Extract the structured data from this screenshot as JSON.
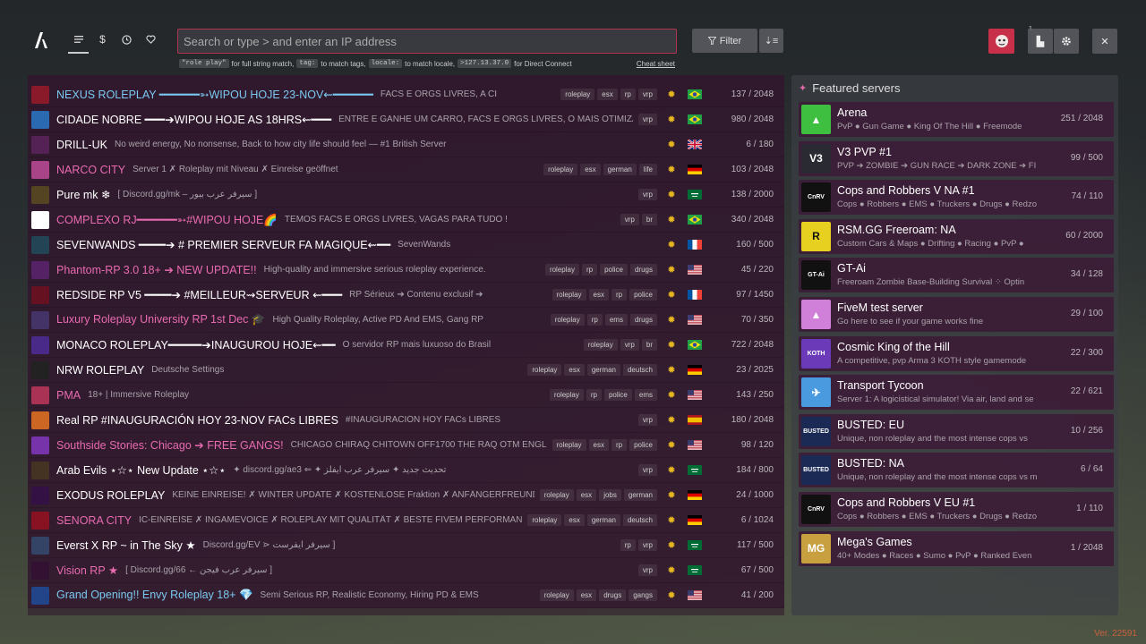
{
  "app": {
    "version": "Ver. 22591"
  },
  "nav": {
    "tabs": [
      {
        "icon": "list-icon"
      },
      {
        "icon": "dollar-icon"
      },
      {
        "icon": "clock-icon"
      },
      {
        "icon": "heart-icon"
      }
    ]
  },
  "search": {
    "placeholder": "Search or type > and enter an IP address"
  },
  "hints": {
    "code1": "\"role play\"",
    "text1": "for full string match,",
    "code2": "tag:",
    "text2": "to match tags,",
    "code3": "locale:",
    "text3": "to match locale,",
    "code4": ">127.13.37.0",
    "text4": "for Direct Connect",
    "cheat": "Cheat sheet"
  },
  "toolbar": {
    "filter_label": "Filter",
    "notif_count": "1"
  },
  "servers": [
    {
      "name": "NEXUS ROLEPLAY ━━━━━━➳WIPOU HOJE 23-NOV⇜━━━━━━",
      "color": "#7ac8f0",
      "desc": "FACS E ORGS LIVRES, A CI",
      "tags": [
        "roleplay",
        "esx",
        "rp",
        "vrp"
      ],
      "flag": "br",
      "players": "137 / 2048",
      "icon_bg": "#8a1a2a"
    },
    {
      "name": "CIDADE NOBRE ━━━➔WIPOU HOJE AS 18HRS⇜━━━",
      "color": "#ffffff",
      "desc": "ENTRE E GANHE UM CARRO, FACS E ORGS LIVRES, O MAIS OTIMIZA",
      "tags": [
        "vrp"
      ],
      "flag": "br",
      "players": "980 / 2048",
      "icon_bg": "#2a6ab0"
    },
    {
      "name": "DRILL-UK",
      "color": "#ffffff",
      "desc": "No weird energy, No nonsense, Back to how city life should feel — #1 British Server",
      "tags": [],
      "flag": "gb",
      "players": "6 / 180",
      "icon_bg": "#552255"
    },
    {
      "name": "NARCO CITY",
      "color": "#e86ab0",
      "desc": "Server 1 ✗ Roleplay mit Niveau ✗ Einreise geöffnet",
      "tags": [
        "roleplay",
        "esx",
        "german",
        "life"
      ],
      "flag": "de",
      "players": "103 / 2048",
      "icon_bg": "#aa4488"
    },
    {
      "name": "Pure mk ❄",
      "color": "#ffffff",
      "desc": "[ Discord.gg/mk – سيرفر عرب بيور ]",
      "tags": [
        "vrp"
      ],
      "flag": "sa",
      "players": "138 / 2000",
      "icon_bg": "#554422"
    },
    {
      "name": "COMPLEXO RJ━━━━━━➳#WIPOU HOJE🌈",
      "color": "#e86ab0",
      "desc": "TEMOS FACS E ORGS LIVRES, VAGAS PARA TUDO !",
      "tags": [
        "vrp",
        "br"
      ],
      "flag": "br",
      "players": "340 / 2048",
      "icon_bg": "#ffffff"
    },
    {
      "name": "SEVENWANDS ━━━━➔ # PREMIER SERVEUR FA MAGIQUE⇜━━",
      "color": "#ffffff",
      "desc": "SevenWands",
      "tags": [],
      "flag": "fr",
      "players": "160 / 500",
      "icon_bg": "#224455"
    },
    {
      "name": "Phantom-RP 3.0 18+ ➔ NEW UPDATE!!",
      "color": "#e86ab0",
      "desc": "High-quality and immersive serious roleplay experience.",
      "tags": [
        "roleplay",
        "rp",
        "police",
        "drugs"
      ],
      "flag": "us",
      "players": "45 / 220",
      "icon_bg": "#552266"
    },
    {
      "name": "REDSIDE RP V5 ━━━━➔ #MEILLEUR⇝SERVEUR ⇜━━━",
      "color": "#ffffff",
      "desc": "RP Sérieux ➔ Contenu exclusif ➔",
      "tags": [
        "roleplay",
        "esx",
        "rp",
        "police"
      ],
      "flag": "fr",
      "players": "97 / 1450",
      "icon_bg": "#661122"
    },
    {
      "name": "Luxury Roleplay University RP 1st Dec 🎓",
      "color": "#e86ab0",
      "desc": "High Quality Roleplay, Active PD And EMS, Gang RP",
      "tags": [
        "roleplay",
        "rp",
        "ems",
        "drugs"
      ],
      "flag": "us",
      "players": "70 / 350",
      "icon_bg": "#443366"
    },
    {
      "name": "MONACO ROLEPLAY━━━━━➔INAUGUROU HOJE⇜━━",
      "color": "#ffffff",
      "desc": "O servidor RP mais luxuoso do Brasil",
      "tags": [
        "roleplay",
        "vrp",
        "br"
      ],
      "flag": "br",
      "players": "722 / 2048",
      "icon_bg": "#4a2a88"
    },
    {
      "name": "NRW ROLEPLAY",
      "color": "#ffffff",
      "desc": "Deutsche Settings",
      "tags": [
        "roleplay",
        "esx",
        "german",
        "deutsch"
      ],
      "flag": "de",
      "players": "23 / 2025",
      "icon_bg": "#222222"
    },
    {
      "name": "PMA",
      "color": "#e86ab0",
      "desc": "18+ | Immersive Roleplay",
      "tags": [
        "roleplay",
        "rp",
        "police",
        "ems"
      ],
      "flag": "us",
      "players": "143 / 250",
      "icon_bg": "#aa3355"
    },
    {
      "name": "Real RP #INAUGURACIÓN HOY 23-NOV FACs LIBRES",
      "color": "#ffffff",
      "desc": "#INAUGURACIÓN HOY FACs LIBRES",
      "tags": [
        "vrp"
      ],
      "flag": "es",
      "players": "180 / 2048",
      "icon_bg": "#cc6622"
    },
    {
      "name": "Southside Stories: Chicago ➔ FREE GANGS!",
      "color": "#e86ab0",
      "desc": "CHICAGO CHIRAQ CHITOWN OFF1700 THE RAQ OTM ENGLE",
      "tags": [
        "roleplay",
        "esx",
        "rp",
        "police"
      ],
      "flag": "us",
      "players": "98 / 120",
      "icon_bg": "#7733aa"
    },
    {
      "name": "Arab Evils ⋆☆⋆ New Update ⋆☆⋆",
      "color": "#ffffff",
      "desc": "✦ discord.gg/ae3 ⇐ ✦ تحديث جديد ✦ سيرفر عرب ايفلز",
      "tags": [
        "vrp"
      ],
      "flag": "sa",
      "players": "184 / 800",
      "icon_bg": "#443322"
    },
    {
      "name": "EXODUS ROLEPLAY",
      "color": "#ffffff",
      "desc": "KEINE EINREISE! ✗ WINTER UPDATE ✗ KOSTENLOSE Fraktion ✗ ANFÄNGERFREUNDLIC",
      "tags": [
        "roleplay",
        "esx",
        "jobs",
        "german"
      ],
      "flag": "de",
      "players": "24 / 1000",
      "icon_bg": "#331144"
    },
    {
      "name": "SENORA CITY",
      "color": "#e86ab0",
      "desc": "IC-EINREISE ✗ INGAMEVOICE ✗ ROLEPLAY MIT QUALITÄT ✗ BESTE FIVEM PERFORMANCE",
      "tags": [
        "roleplay",
        "esx",
        "german",
        "deutsch"
      ],
      "flag": "de",
      "players": "6 / 1024",
      "icon_bg": "#881122"
    },
    {
      "name": "Everst X RP ~ in The Sky ★",
      "color": "#ffffff",
      "desc": "Discord.gg/EV ⋗ سيرفر ايفرست ]",
      "tags": [
        "rp",
        "vrp"
      ],
      "flag": "sa",
      "players": "117 / 500",
      "icon_bg": "#334466"
    },
    {
      "name": "Vision RP ★",
      "color": "#e86ab0",
      "desc": "[ Discord.gg/66 ← سيرفر عرب فيجن ]",
      "tags": [
        "vrp"
      ],
      "flag": "sa",
      "players": "67 / 500",
      "icon_bg": "#331133"
    },
    {
      "name": "Grand Opening!! Envy Roleplay 18+ 💎",
      "color": "#7ac8f0",
      "desc": "Semi Serious RP, Realistic Economy, Hiring PD & EMS",
      "tags": [
        "roleplay",
        "esx",
        "drugs",
        "gangs"
      ],
      "flag": "us",
      "players": "41 / 200",
      "icon_bg": "#224488"
    }
  ],
  "featured": {
    "title": "Featured servers",
    "items": [
      {
        "name": "Arena",
        "desc": "PvP ● Gun Game ● King Of The Hill ● Freemode",
        "players": "251 / 2048",
        "icon_text": "▲",
        "icon_bg": "#3fbf3f"
      },
      {
        "name": "V3 PVP #1",
        "desc": "PVP ➔ ZOMBIE ➔ GUN RACE ➔ DARK ZONE ➔ FI",
        "players": "99 / 500",
        "icon_text": "V3",
        "icon_bg": "#2a2a33"
      },
      {
        "name": "Cops and Robbers V NA #1",
        "desc": "Cops ● Robbers ● EMS ● Truckers ● Drugs ● Redzo",
        "players": "74 / 110",
        "icon_text": "CnRV",
        "icon_bg": "#111111"
      },
      {
        "name": "RSM.GG Freeroam: NA",
        "desc": "Custom Cars & Maps ● Drifting ● Racing ● PvP ●",
        "players": "60 / 2000",
        "icon_text": "R",
        "icon_bg": "#e8d020"
      },
      {
        "name": "GT-Ai",
        "desc": "Freeroam Zombie Base-Building Survival ⁘ Optin",
        "players": "34 / 128",
        "icon_text": "GT-Ai",
        "icon_bg": "#111111"
      },
      {
        "name": "FiveM test server",
        "desc": "Go here to see if your game works fine",
        "players": "29 / 100",
        "icon_text": "▲",
        "icon_bg": "#d080d8"
      },
      {
        "name": "Cosmic King of the Hill",
        "desc": "A competitive, pvp Arma 3 KOTH style gamemode",
        "players": "22 / 300",
        "icon_text": "KOTH",
        "icon_bg": "#6a3ab8"
      },
      {
        "name": "Transport Tycoon",
        "desc": "Server 1: A logicistical simulator! Via air, land and se",
        "players": "22 / 621",
        "icon_text": "✈",
        "icon_bg": "#4a9ae0"
      },
      {
        "name": "BUSTED: EU",
        "desc": "Unique, non roleplay and the most intense cops vs",
        "players": "10 / 256",
        "icon_text": "BUSTED",
        "icon_bg": "#1a2a55"
      },
      {
        "name": "BUSTED: NA",
        "desc": "Unique, non roleplay and the most intense cops vs m",
        "players": "6 / 64",
        "icon_text": "BUSTED",
        "icon_bg": "#1a2a55"
      },
      {
        "name": "Cops and Robbers V EU #1",
        "desc": "Cops ● Robbers ● EMS ● Truckers ● Drugs ● Redzo",
        "players": "1 / 110",
        "icon_text": "CnRV",
        "icon_bg": "#111111"
      },
      {
        "name": "Mega's Games",
        "desc": "40+ Modes ● Races ● Sumo ● PvP ● Ranked Even",
        "players": "1 / 2048",
        "icon_text": "MG",
        "icon_bg": "#c8a040"
      }
    ]
  }
}
